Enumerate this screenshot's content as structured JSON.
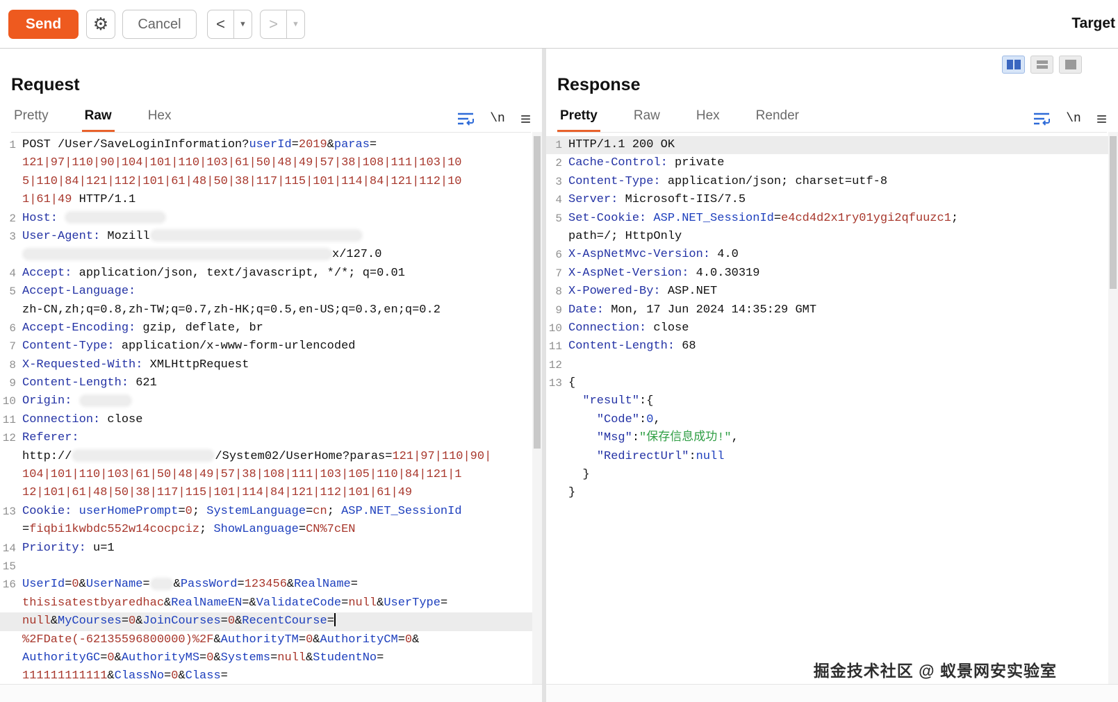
{
  "toolbar": {
    "send": "Send",
    "cancel": "Cancel",
    "target": "Target"
  },
  "icons": {
    "gear": "⚙",
    "back": "<",
    "forward": ">",
    "dropdown": "▼",
    "newline": "\\n",
    "hamburger": "≡"
  },
  "colors": {
    "accent_orange": "#ee5a1f",
    "tab_underline": "#e8622c",
    "layout_active_blue": "#3a66c0",
    "header_blue": "#2433a5",
    "value_red": "#a8372c",
    "json_green": "#2f9e44"
  },
  "request": {
    "title": "Request",
    "tabs": [
      "Pretty",
      "Raw",
      "Hex"
    ],
    "active_tab": "Raw",
    "lines": [
      {
        "n": "1",
        "t": [
          [
            "d",
            "POST /User/SaveLoginInformation?"
          ],
          [
            "p",
            "userId"
          ],
          [
            "d",
            "="
          ],
          [
            "v",
            "2019"
          ],
          [
            "d",
            "&"
          ],
          [
            "p",
            "paras"
          ],
          [
            "d",
            "="
          ]
        ]
      },
      {
        "n": "",
        "t": [
          [
            "v",
            "121|97|110|90|104|101|110|103|61|50|48|49|57|38|108|111|103|10"
          ]
        ]
      },
      {
        "n": "",
        "t": [
          [
            "v",
            "5|110|84|121|112|101|61|48|50|38|117|115|101|114|84|121|112|10"
          ]
        ]
      },
      {
        "n": "",
        "t": [
          [
            "v",
            "1|61|49"
          ],
          [
            "d",
            " HTTP/1.1"
          ]
        ]
      },
      {
        "n": "2",
        "t": [
          [
            "h",
            "Host:"
          ],
          [
            "d",
            " "
          ],
          [
            "r",
            "140"
          ]
        ]
      },
      {
        "n": "3",
        "t": [
          [
            "h",
            "User-Agent:"
          ],
          [
            "d",
            " Mozill"
          ],
          [
            "r",
            "300"
          ]
        ]
      },
      {
        "n": "",
        "t": [
          [
            "r",
            "440"
          ],
          [
            "d",
            "x/127.0"
          ]
        ]
      },
      {
        "n": "4",
        "t": [
          [
            "h",
            "Accept:"
          ],
          [
            "d",
            " application/json, text/javascript, */*; q=0.01"
          ]
        ]
      },
      {
        "n": "5",
        "t": [
          [
            "h",
            "Accept-Language:"
          ]
        ]
      },
      {
        "n": "",
        "t": [
          [
            "d",
            "zh-CN,zh;q=0.8,zh-TW;q=0.7,zh-HK;q=0.5,en-US;q=0.3,en;q=0.2"
          ]
        ]
      },
      {
        "n": "6",
        "t": [
          [
            "h",
            "Accept-Encoding:"
          ],
          [
            "d",
            " gzip, deflate, br"
          ]
        ]
      },
      {
        "n": "7",
        "t": [
          [
            "h",
            "Content-Type:"
          ],
          [
            "d",
            " application/x-www-form-urlencoded"
          ]
        ]
      },
      {
        "n": "8",
        "t": [
          [
            "h",
            "X-Requested-With:"
          ],
          [
            "d",
            " XMLHttpRequest"
          ]
        ]
      },
      {
        "n": "9",
        "t": [
          [
            "h",
            "Content-Length:"
          ],
          [
            "d",
            " 621"
          ]
        ]
      },
      {
        "n": "10",
        "t": [
          [
            "h",
            "Origin:"
          ],
          [
            "d",
            " "
          ],
          [
            "r",
            "70"
          ]
        ]
      },
      {
        "n": "11",
        "t": [
          [
            "h",
            "Connection:"
          ],
          [
            "d",
            " close"
          ]
        ]
      },
      {
        "n": "12",
        "t": [
          [
            "h",
            "Referer:"
          ]
        ]
      },
      {
        "n": "",
        "t": [
          [
            "d",
            "http://"
          ],
          [
            "r",
            "200"
          ],
          [
            "d",
            "/System02/UserHome?paras="
          ],
          [
            "v",
            "121|97|110|90|"
          ]
        ]
      },
      {
        "n": "",
        "t": [
          [
            "v",
            "104|101|110|103|61|50|48|49|57|38|108|111|103|105|110|84|121|1"
          ]
        ]
      },
      {
        "n": "",
        "t": [
          [
            "v",
            "12|101|61|48|50|38|117|115|101|114|84|121|112|101|61|49"
          ]
        ]
      },
      {
        "n": "13",
        "t": [
          [
            "h",
            "Cookie:"
          ],
          [
            "d",
            " "
          ],
          [
            "p",
            "userHomePrompt"
          ],
          [
            "d",
            "="
          ],
          [
            "v",
            "0"
          ],
          [
            "d",
            "; "
          ],
          [
            "p",
            "SystemLanguage"
          ],
          [
            "d",
            "="
          ],
          [
            "v",
            "cn"
          ],
          [
            "d",
            "; "
          ],
          [
            "p",
            "ASP.NET_SessionId"
          ]
        ]
      },
      {
        "n": "",
        "t": [
          [
            "d",
            "="
          ],
          [
            "v",
            "fiqbi1kwbdc552w14cocpciz"
          ],
          [
            "d",
            "; "
          ],
          [
            "p",
            "ShowLanguage"
          ],
          [
            "d",
            "="
          ],
          [
            "v",
            "CN%7cEN"
          ]
        ]
      },
      {
        "n": "14",
        "t": [
          [
            "h",
            "Priority:"
          ],
          [
            "d",
            " u=1"
          ]
        ]
      },
      {
        "n": "15",
        "t": []
      },
      {
        "n": "16",
        "t": [
          [
            "p",
            "UserId"
          ],
          [
            "d",
            "="
          ],
          [
            "v",
            "0"
          ],
          [
            "d",
            "&"
          ],
          [
            "p",
            "UserName"
          ],
          [
            "d",
            "="
          ],
          [
            "r",
            "28"
          ],
          [
            "d",
            "&"
          ],
          [
            "p",
            "PassWord"
          ],
          [
            "d",
            "="
          ],
          [
            "v",
            "123456"
          ],
          [
            "d",
            "&"
          ],
          [
            "p",
            "RealName"
          ],
          [
            "d",
            "="
          ]
        ]
      },
      {
        "n": "",
        "t": [
          [
            "v",
            "thisisatestbyaredhac"
          ],
          [
            "d",
            "&"
          ],
          [
            "p",
            "RealNameEN"
          ],
          [
            "d",
            "=&"
          ],
          [
            "p",
            "ValidateCode"
          ],
          [
            "d",
            "="
          ],
          [
            "v",
            "null"
          ],
          [
            "d",
            "&"
          ],
          [
            "p",
            "UserType"
          ],
          [
            "d",
            "="
          ]
        ]
      },
      {
        "n": "",
        "hl": true,
        "t": [
          [
            "v",
            "null"
          ],
          [
            "d",
            "&"
          ],
          [
            "p",
            "MyCourses"
          ],
          [
            "d",
            "="
          ],
          [
            "v",
            "0"
          ],
          [
            "d",
            "&"
          ],
          [
            "p",
            "JoinCourses"
          ],
          [
            "d",
            "="
          ],
          [
            "v",
            "0"
          ],
          [
            "d",
            "&"
          ],
          [
            "p",
            "RecentCourse"
          ],
          [
            "d",
            "="
          ],
          [
            "cur",
            ""
          ]
        ]
      },
      {
        "n": "",
        "t": [
          [
            "v",
            "%2FDate(-62135596800000)%2F"
          ],
          [
            "d",
            "&"
          ],
          [
            "p",
            "AuthorityTM"
          ],
          [
            "d",
            "="
          ],
          [
            "v",
            "0"
          ],
          [
            "d",
            "&"
          ],
          [
            "p",
            "AuthorityCM"
          ],
          [
            "d",
            "="
          ],
          [
            "v",
            "0"
          ],
          [
            "d",
            "&"
          ]
        ]
      },
      {
        "n": "",
        "t": [
          [
            "p",
            "AuthorityGC"
          ],
          [
            "d",
            "="
          ],
          [
            "v",
            "0"
          ],
          [
            "d",
            "&"
          ],
          [
            "p",
            "AuthorityMS"
          ],
          [
            "d",
            "="
          ],
          [
            "v",
            "0"
          ],
          [
            "d",
            "&"
          ],
          [
            "p",
            "Systems"
          ],
          [
            "d",
            "="
          ],
          [
            "v",
            "null"
          ],
          [
            "d",
            "&"
          ],
          [
            "p",
            "StudentNo"
          ],
          [
            "d",
            "="
          ]
        ]
      },
      {
        "n": "",
        "t": [
          [
            "v",
            "111111111111"
          ],
          [
            "d",
            "&"
          ],
          [
            "p",
            "ClassNo"
          ],
          [
            "d",
            "="
          ],
          [
            "v",
            "0"
          ],
          [
            "d",
            "&"
          ],
          [
            "p",
            "Class"
          ],
          [
            "d",
            "="
          ]
        ]
      }
    ]
  },
  "response": {
    "title": "Response",
    "tabs": [
      "Pretty",
      "Raw",
      "Hex",
      "Render"
    ],
    "active_tab": "Pretty",
    "lines": [
      {
        "n": "1",
        "hl": true,
        "t": [
          [
            "d",
            "HTTP/1.1 200 OK"
          ]
        ]
      },
      {
        "n": "2",
        "t": [
          [
            "h",
            "Cache-Control:"
          ],
          [
            "d",
            " private"
          ]
        ]
      },
      {
        "n": "3",
        "t": [
          [
            "h",
            "Content-Type:"
          ],
          [
            "d",
            " application/json; charset=utf-8"
          ]
        ]
      },
      {
        "n": "4",
        "t": [
          [
            "h",
            "Server:"
          ],
          [
            "d",
            " Microsoft-IIS/7.5"
          ]
        ]
      },
      {
        "n": "5",
        "t": [
          [
            "h",
            "Set-Cookie:"
          ],
          [
            "d",
            " "
          ],
          [
            "p",
            "ASP.NET_SessionId"
          ],
          [
            "d",
            "="
          ],
          [
            "v",
            "e4cd4d2x1ry01ygi2qfuuzc1"
          ],
          [
            "d",
            ";"
          ]
        ]
      },
      {
        "n": "",
        "t": [
          [
            "d",
            "path=/; HttpOnly"
          ]
        ]
      },
      {
        "n": "6",
        "t": [
          [
            "h",
            "X-AspNetMvc-Version:"
          ],
          [
            "d",
            " 4.0"
          ]
        ]
      },
      {
        "n": "7",
        "t": [
          [
            "h",
            "X-AspNet-Version:"
          ],
          [
            "d",
            " 4.0.30319"
          ]
        ]
      },
      {
        "n": "8",
        "t": [
          [
            "h",
            "X-Powered-By:"
          ],
          [
            "d",
            " ASP.NET"
          ]
        ]
      },
      {
        "n": "9",
        "t": [
          [
            "h",
            "Date:"
          ],
          [
            "d",
            " Mon, 17 Jun 2024 14:35:29 GMT"
          ]
        ]
      },
      {
        "n": "10",
        "t": [
          [
            "h",
            "Connection:"
          ],
          [
            "d",
            " close"
          ]
        ]
      },
      {
        "n": "11",
        "t": [
          [
            "h",
            "Content-Length:"
          ],
          [
            "d",
            " 68"
          ]
        ]
      },
      {
        "n": "12",
        "t": []
      },
      {
        "n": "13",
        "t": [
          [
            "d",
            "{"
          ]
        ]
      },
      {
        "n": "",
        "t": [
          [
            "d",
            "  "
          ],
          [
            "h",
            "\"result\""
          ],
          [
            "d",
            ":{"
          ]
        ]
      },
      {
        "n": "",
        "t": [
          [
            "d",
            "    "
          ],
          [
            "h",
            "\"Code\""
          ],
          [
            "d",
            ":"
          ],
          [
            "b",
            "0"
          ],
          [
            "d",
            ","
          ]
        ]
      },
      {
        "n": "",
        "t": [
          [
            "d",
            "    "
          ],
          [
            "h",
            "\"Msg\""
          ],
          [
            "d",
            ":"
          ],
          [
            "g",
            "\"保存信息成功!\""
          ],
          [
            "d",
            ","
          ]
        ]
      },
      {
        "n": "",
        "t": [
          [
            "d",
            "    "
          ],
          [
            "h",
            "\"RedirectUrl\""
          ],
          [
            "d",
            ":"
          ],
          [
            "b",
            "null"
          ]
        ]
      },
      {
        "n": "",
        "t": [
          [
            "d",
            "  }"
          ]
        ]
      },
      {
        "n": "",
        "t": [
          [
            "d",
            "}"
          ]
        ]
      }
    ]
  },
  "watermark": "掘金技术社区 @ 蚁景网安实验室"
}
